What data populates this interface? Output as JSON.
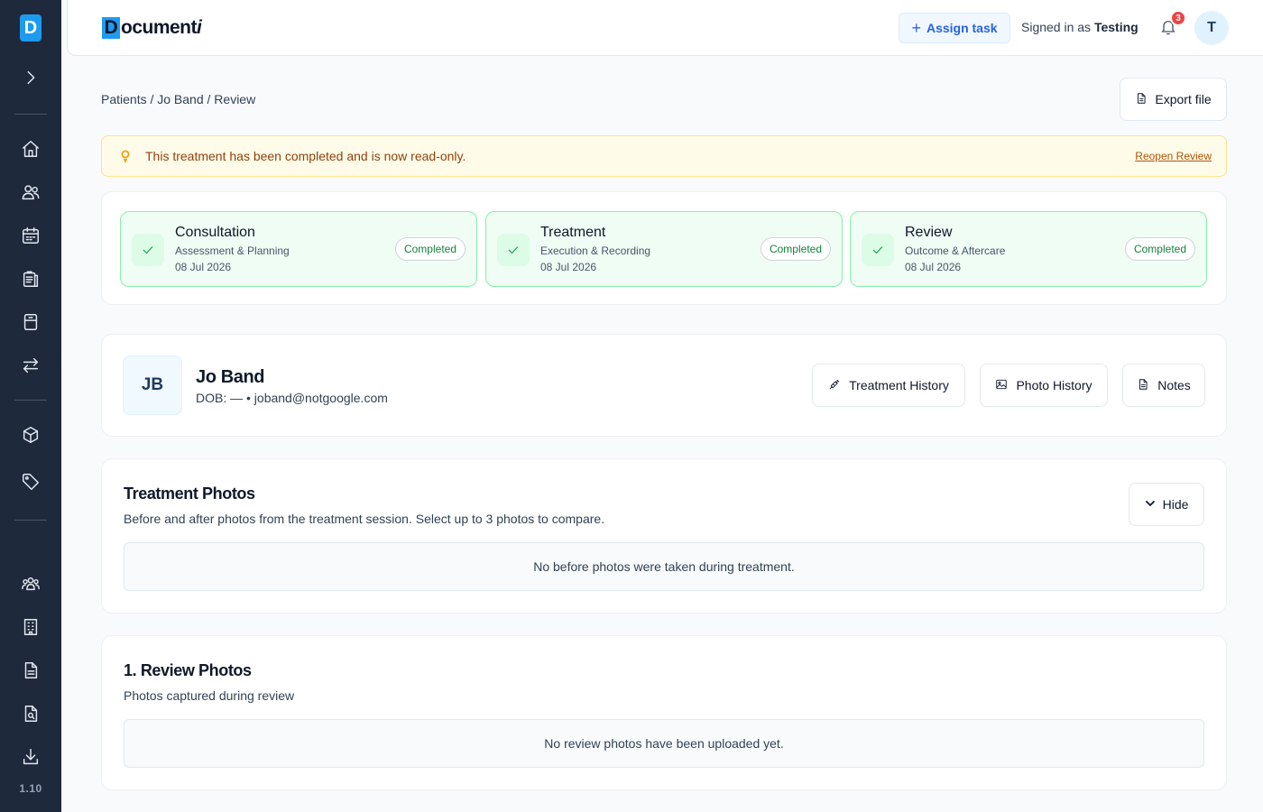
{
  "app": {
    "logo_letter": "D",
    "brand_name": "Documenti",
    "version": "1.10"
  },
  "sidebar": {
    "icons": [
      "expand-icon",
      "home-icon",
      "users-icon",
      "calendar-icon",
      "clipboard-icon",
      "cabinet-icon",
      "transfer-icon",
      "box-icon",
      "tag-icon",
      "team-icon",
      "building-icon",
      "document-icon",
      "search-document-icon",
      "download-icon"
    ]
  },
  "header": {
    "assign_task_label": "Assign task",
    "signed_in_prefix": "Signed in as",
    "signed_in_user": "Testing",
    "notification_count": "3",
    "avatar_initial": "T"
  },
  "breadcrumb": "Patients / Jo Band / Review",
  "export_label": "Export file",
  "alert": {
    "message": "This treatment has been completed and is now read-only.",
    "action_label": "Reopen Review"
  },
  "stages": [
    {
      "title": "Consultation",
      "subtitle": "Assessment & Planning",
      "date": "08 Jul 2026",
      "status": "Completed"
    },
    {
      "title": "Treatment",
      "subtitle": "Execution & Recording",
      "date": "08 Jul 2026",
      "status": "Completed"
    },
    {
      "title": "Review",
      "subtitle": "Outcome & Aftercare",
      "date": "08 Jul 2026",
      "status": "Completed"
    }
  ],
  "patient": {
    "initials": "JB",
    "name": "Jo Band",
    "meta": "DOB: — • joband@notgoogle.com",
    "treatment_history_label": "Treatment History",
    "photo_history_label": "Photo History",
    "notes_label": "Notes"
  },
  "treatment_photos": {
    "title": "Treatment Photos",
    "description": "Before and after photos from the treatment session. Select up to 3 photos to compare.",
    "hide_label": "Hide",
    "empty_message": "No before photos were taken during treatment."
  },
  "review_photos": {
    "title": "1. Review Photos",
    "description": "Photos captured during review",
    "empty_message": "No review photos have been uploaded yet."
  },
  "colors": {
    "sidebar_bg": "#1e293b",
    "brand_blue": "#1d9bf0",
    "success_green": "#16a34a",
    "alert_amber": "#92400e",
    "badge_red": "#ef4444"
  }
}
